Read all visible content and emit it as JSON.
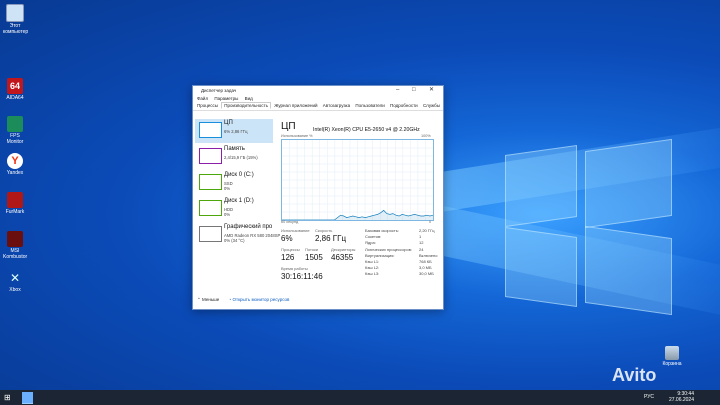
{
  "desktop_icons": [
    {
      "label": "Этот компьютер",
      "color": "#cfe3f7"
    },
    {
      "label": "AIDA64",
      "color": "#c0171f"
    },
    {
      "label": "FPS Monitor",
      "color": "#1c8c5a"
    },
    {
      "label": "Yandex",
      "color": "#ffffff"
    },
    {
      "label": "FurMark",
      "color": "#b01818"
    },
    {
      "label": "MSI Kombustor",
      "color": "#6b0e0e"
    },
    {
      "label": "Xbox",
      "color": "#2f7d2f"
    }
  ],
  "window": {
    "title": "Диспетчер задач",
    "menu": [
      "Файл",
      "Параметры",
      "Вид"
    ],
    "tabs": [
      "Процессы",
      "Производительность",
      "Журнал приложений",
      "Автозагрузка",
      "Пользователи",
      "Подробности",
      "Службы"
    ],
    "active_tab": "Производительность",
    "sidebar": [
      {
        "title": "ЦП",
        "sub1": "6% 2,86 ГГц",
        "sub2": ""
      },
      {
        "title": "Память",
        "sub1": "2,4/15,9 ГБ (15%)",
        "sub2": ""
      },
      {
        "title": "Диск 0 (C:)",
        "sub1": "SSD",
        "sub2": "0%"
      },
      {
        "title": "Диск 1 (D:)",
        "sub1": "HDD",
        "sub2": "0%"
      },
      {
        "title": "Графический про",
        "sub1": "AMD Radeon RX 580 2048SP",
        "sub2": "0% (34 °C)"
      }
    ],
    "cpu": {
      "heading": "ЦП",
      "name": "Intel(R) Xeon(R) CPU E5-2650 v4 @ 2.20GHz",
      "graph_top_left": "Использование %",
      "graph_top_right": "100%",
      "graph_bottom_left": "60 секунд",
      "graph_bottom_right": "0",
      "usage_values": [
        0,
        0,
        0,
        0,
        0,
        0,
        0,
        0,
        0,
        0,
        0,
        0,
        0,
        0,
        0,
        0,
        0,
        0,
        3,
        6,
        5,
        3,
        4,
        5,
        4,
        3,
        4,
        3,
        4,
        5,
        6,
        7,
        9,
        12,
        8,
        7,
        8,
        6,
        5,
        7,
        6,
        5,
        6,
        7,
        6,
        5,
        5,
        6,
        5,
        6
      ]
    },
    "stats": {
      "usage_label": "Использование",
      "usage": "6%",
      "speed_label": "Скорость",
      "speed": "2,86 ГГц",
      "processes_label": "Процессы",
      "processes": "126",
      "threads_label": "Потоки",
      "threads": "1505",
      "handles_label": "Дескрипторы",
      "handles": "46355",
      "uptime_label": "Время работы",
      "uptime": "30:16:11:46"
    },
    "details": [
      {
        "k": "Базовая скорость:",
        "v": "2,20 ГГц"
      },
      {
        "k": "Сокетов:",
        "v": "1"
      },
      {
        "k": "Ядра:",
        "v": "12"
      },
      {
        "k": "Логических процессоров:",
        "v": "24"
      },
      {
        "k": "Виртуализация:",
        "v": "Включено"
      },
      {
        "k": "Кэш L1:",
        "v": "768 КБ"
      },
      {
        "k": "Кэш L2:",
        "v": "3,0 МБ"
      },
      {
        "k": "Кэш L3:",
        "v": "30,0 МБ"
      }
    ],
    "footer": {
      "less": "Меньше",
      "monitor": "Открыть монитор ресурсов"
    }
  },
  "taskbar": {
    "lang": "РУС",
    "time": "9:30:44",
    "date": "27.06.2024"
  },
  "recycle_bin": "Корзина",
  "watermark": "Avito"
}
